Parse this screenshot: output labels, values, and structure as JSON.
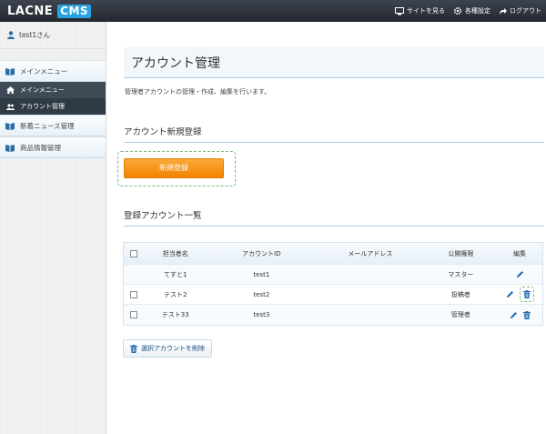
{
  "header": {
    "logo_text": "LACNE",
    "logo_badge": "CMS",
    "links": [
      {
        "label": "サイトを見る",
        "icon": "monitor-icon"
      },
      {
        "label": "各種設定",
        "icon": "gear-icon"
      },
      {
        "label": "ログアウト",
        "icon": "logout-arrow-icon"
      }
    ]
  },
  "sidebar": {
    "user": "test1さん",
    "items": [
      {
        "label": "メインメニュー",
        "icon": "book-icon"
      },
      {
        "label": "メインメニュー",
        "icon": "home-icon"
      },
      {
        "label": "アカウント管理",
        "icon": "users-icon"
      },
      {
        "label": "新着ニュース管理",
        "icon": "book-icon"
      },
      {
        "label": "商品情報管理",
        "icon": "book-icon"
      }
    ]
  },
  "main": {
    "title": "アカウント管理",
    "description": "管理者アカウントの管理・作成、編集を行います。",
    "new_section_title": "アカウント新規登録",
    "new_button": "新規登録",
    "list_section_title": "登録アカウント一覧",
    "table": {
      "headers": [
        "担当者名",
        "アカウントID",
        "メールアドレス",
        "公開権限",
        "編集"
      ],
      "rows": [
        {
          "name": "てすと1",
          "id": "test1",
          "email": "",
          "role": "マスター",
          "checkbox": false,
          "deletable": false
        },
        {
          "name": "テスト2",
          "id": "test2",
          "email": "",
          "role": "投稿者",
          "checkbox": true,
          "deletable": true
        },
        {
          "name": "テスト33",
          "id": "test3",
          "email": "",
          "role": "管理者",
          "checkbox": true,
          "deletable": true
        }
      ]
    },
    "delete_button": "選択アカウントを削除"
  },
  "colors": {
    "accent_blue": "#2a7fc0",
    "orange_button": "#f39218",
    "topbar": "#2d323b"
  }
}
